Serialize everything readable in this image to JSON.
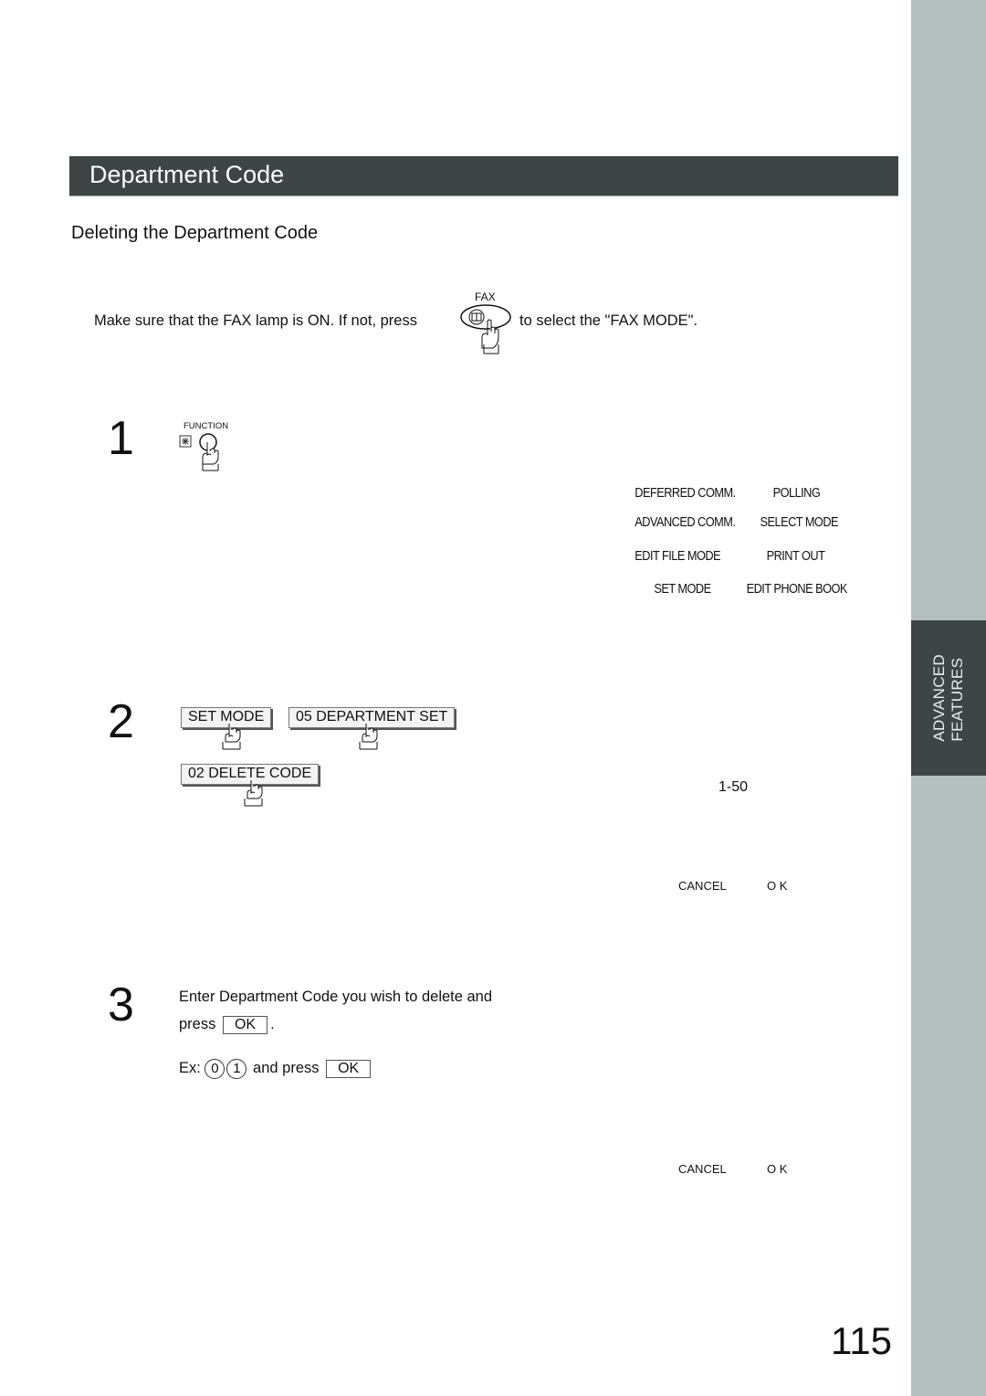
{
  "section": {
    "title": "Department Code",
    "subtitle": "Deleting the Department Code"
  },
  "side_tab": {
    "label": "ADVANCED\nFEATURES",
    "colors": {
      "strip": "#b3c0be",
      "tab": "#3d4545"
    }
  },
  "intro": {
    "before": "Make sure that the FAX lamp is ON.  If not, press",
    "key_label": "FAX",
    "after": "to select the \"FAX MODE\"."
  },
  "step1": {
    "number": "1",
    "key_label": "FUNCTION",
    "key_symbol": "∗",
    "menu": [
      {
        "left": "DEFERRED COMM.",
        "right": "POLLING"
      },
      {
        "left": "ADVANCED COMM.",
        "right": "SELECT MODE"
      },
      {
        "left": "EDIT FILE MODE",
        "right": "PRINT OUT"
      },
      {
        "left": "SET MODE",
        "right": "EDIT PHONE BOOK"
      }
    ]
  },
  "step2": {
    "number": "2",
    "keys": [
      "SET MODE",
      "05 DEPARTMENT SET",
      "02 DELETE CODE"
    ],
    "range": "1-50",
    "cancel": "CANCEL",
    "ok": "O K"
  },
  "step3": {
    "number": "3",
    "line1": "Enter Department Code you wish to delete and",
    "line2_prefix": "press",
    "ok_key": "OK",
    "line2_suffix": ".",
    "example_prefix": "Ex:",
    "example_digits": [
      "0",
      "1"
    ],
    "example_middle": "and press",
    "example_ok": "OK",
    "cancel": "CANCEL",
    "ok": "O K"
  },
  "page_number": "115"
}
